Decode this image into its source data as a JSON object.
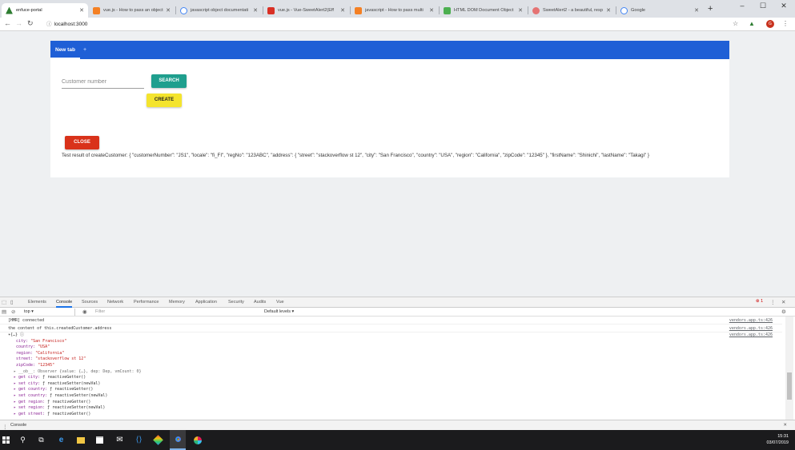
{
  "browser": {
    "tabs": [
      {
        "title": "enfuce-portal",
        "color": "#2e7d32",
        "active": true
      },
      {
        "title": "vue.js - How to pass an object",
        "color": "#f48024",
        "active": false
      },
      {
        "title": "javascript object documentati",
        "color": "#4285f4",
        "active": false
      },
      {
        "title": "vue.js - Vue-SweetAlert2(Eff",
        "color": "#d93025",
        "active": false
      },
      {
        "title": "javascript - How to pass multi",
        "color": "#f48024",
        "active": false
      },
      {
        "title": "HTML DOM Document Object",
        "color": "#4caf50",
        "active": false
      },
      {
        "title": "SweetAlert2 - a beautiful, resp",
        "color": "#e57373",
        "active": false
      },
      {
        "title": "Google",
        "color": "#4285f4",
        "active": false
      }
    ],
    "address": {
      "proto": "ⓘ",
      "url": "localhost:3000"
    },
    "avatar_letter": "G"
  },
  "app": {
    "tab_label": "New tab",
    "tab_add": "+",
    "customer_placeholder": "Customer number",
    "search_label": "SEARCH",
    "create_label": "CREATE",
    "close_label": "CLOSE",
    "result_text": "Test result of createCustomer: { \"customerNumber\": \"JS1\", \"locale\": \"fi_FI\", \"regNo\": \"123ABC\", \"address\": { \"street\": \"stackoverflow st 12\", \"city\": \"San Francisco\", \"country\": \"USA\", \"region\": \"California\", \"zipCode\": \"12345\" }, \"firstName\": \"Shinichi\", \"lastName\": \"Takagi\" }"
  },
  "devtools": {
    "tabs": [
      "Elements",
      "Console",
      "Sources",
      "Network",
      "Performance",
      "Memory",
      "Application",
      "Security",
      "Audits",
      "Vue"
    ],
    "active_tab": "Console",
    "error_count": "1",
    "context": "top",
    "filter_placeholder": "Filter",
    "levels": "Default levels ▾",
    "drawer_label": "Console",
    "source_ref": "vendors.app.ts:426",
    "lines": {
      "l1": "[HMR] connected",
      "l2": "the content of this.createdCustomer.address",
      "l3": "▾{…} ⓘ",
      "l4k": "city: ",
      "l4v": "\"San Francisco\"",
      "l5k": "country: ",
      "l5v": "\"USA\"",
      "l6k": "region: ",
      "l6v": "\"California\"",
      "l7k": "street: ",
      "l7v": "\"stackoverflow st 12\"",
      "l8k": "zipCode: ",
      "l8v": "\"12345\"",
      "l9": "▸ __ob__: Observer {value: {…}, dep: Dep, vmCount: 0}",
      "l10k": "▸ get city: ",
      "l10v": "ƒ reactiveGetter()",
      "l11k": "▸ set city: ",
      "l11v": "ƒ reactiveSetter(newVal)",
      "l12k": "▸ get country: ",
      "l12v": "ƒ reactiveGetter()",
      "l13k": "▸ set country: ",
      "l13v": "ƒ reactiveSetter(newVal)",
      "l14k": "▸ get region: ",
      "l14v": "ƒ reactiveGetter()",
      "l15k": "▸ set region: ",
      "l15v": "ƒ reactiveSetter(newVal)",
      "l16k": "▸ get street: ",
      "l16v": "ƒ reactiveGetter()"
    }
  },
  "taskbar": {
    "time": "15:31",
    "date": "03/07/2019"
  }
}
